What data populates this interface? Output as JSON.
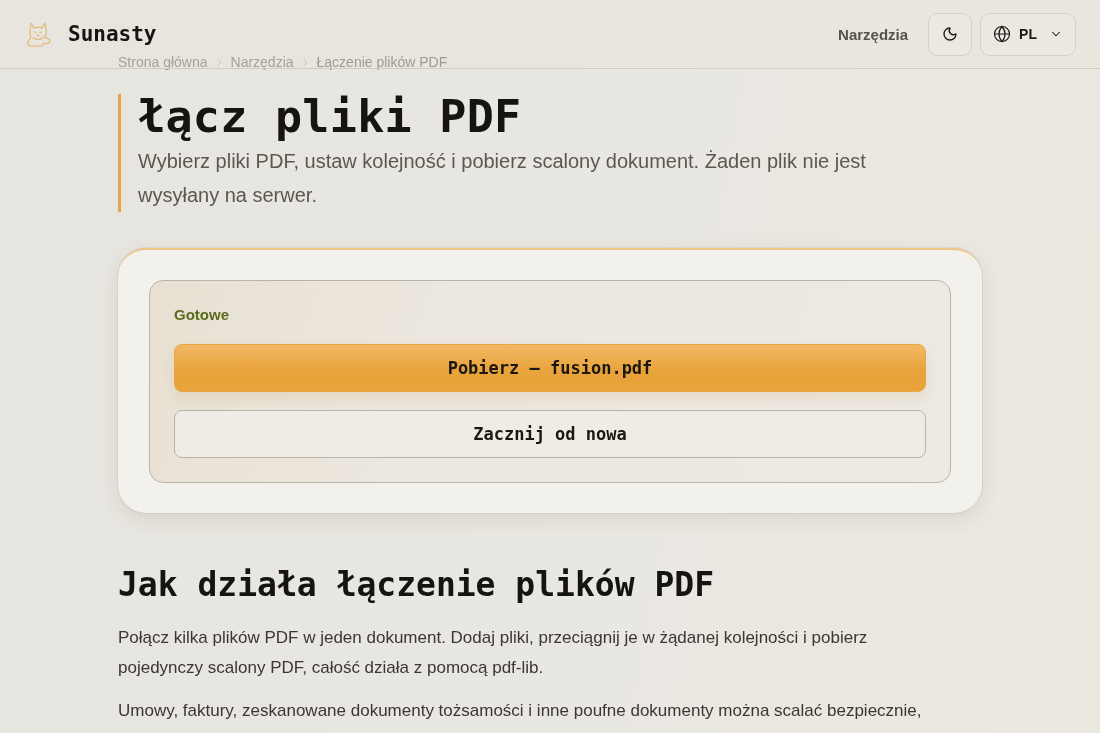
{
  "header": {
    "brand": "Sunasty",
    "nav_link": "Narzędzia",
    "language": "PL"
  },
  "breadcrumb": [
    {
      "label": "Strona główna"
    },
    {
      "label": "Narzędzia"
    },
    {
      "label": "Łączenie plików PDF"
    }
  ],
  "hero": {
    "title": "łącz pliki PDF",
    "subtitle": "Wybierz pliki PDF, ustaw kolejność i pobierz scalony dokument. Żaden plik nie jest wysyłany na serwer."
  },
  "result_panel": {
    "status": "Gotowe",
    "buttons": [
      {
        "kind": "primary",
        "label": "Pobierz — fusion.pdf"
      },
      {
        "kind": "secondary",
        "label": "Zacznij od nowa"
      }
    ]
  },
  "article": {
    "heading": "Jak działa łączenie plików PDF",
    "paragraphs": [
      "Połącz kilka plików PDF w jeden dokument. Dodaj pliki, przeciągnij je w żądanej kolejności i pobierz pojedynczy scalony PDF, całość działa z pomocą pdf-lib.",
      "Umowy, faktury, zeskanowane dokumenty tożsamości i inne poufne dokumenty można scalać bezpiecznie,"
    ]
  }
}
